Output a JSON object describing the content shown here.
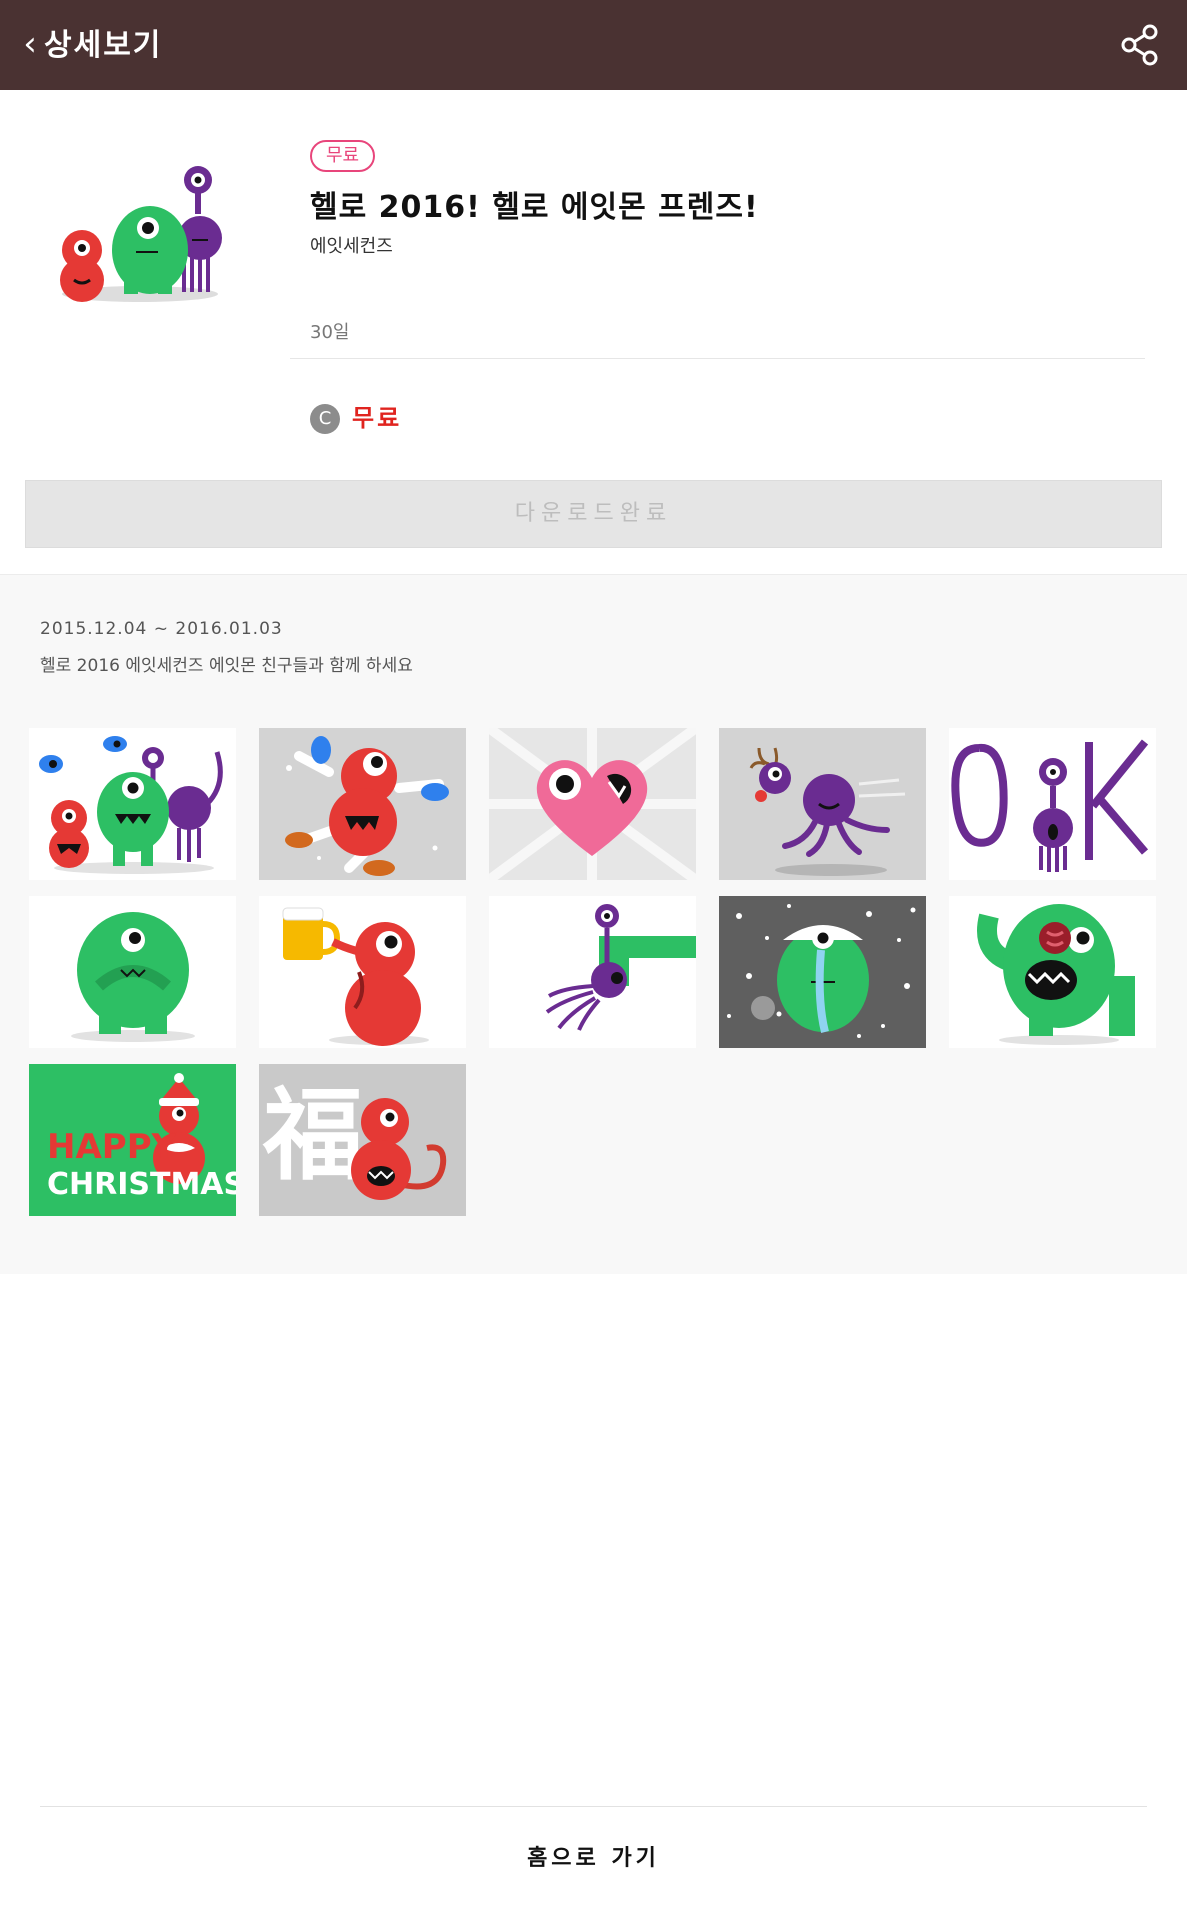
{
  "header": {
    "back_icon": "chevron-left-icon",
    "title": "상세보기",
    "share_icon": "share-icon"
  },
  "item": {
    "badge": "무료",
    "title": "헬로 2016! 헬로 에잇몬 프렌즈!",
    "author": "에잇세컨즈",
    "period": "30일",
    "coin_symbol": "C",
    "price": "무료",
    "download_label": "다운로드완료"
  },
  "event": {
    "dates": "2015.12.04 ~ 2016.01.03",
    "description": "헬로 2016 에잇세컨즈 에잇몬 친구들과 함께 하세요"
  },
  "stickers": [
    "friends-group",
    "red-mascot-dancing",
    "heart-mascot",
    "purple-reindeer-mascot",
    "ok-text-mascot",
    "green-mascot-shy",
    "red-mascot-beer",
    "purple-mascot-pulled",
    "green-mascot-snow-crying",
    "green-mascot-eating",
    "happy-christmas-card",
    "fortune-monkey-card"
  ],
  "sticker_text": {
    "happy": "HAPPY",
    "christmas": "CHRISTMAS",
    "fortune_char": "福"
  },
  "footer": {
    "home_label": "홈으로 가기"
  },
  "colors": {
    "header_bg": "#4a3232",
    "accent_pink": "#e8457b",
    "price_red": "#e0241f",
    "green": "#2dbf64",
    "red": "#e53935",
    "purple": "#6a2c91"
  }
}
